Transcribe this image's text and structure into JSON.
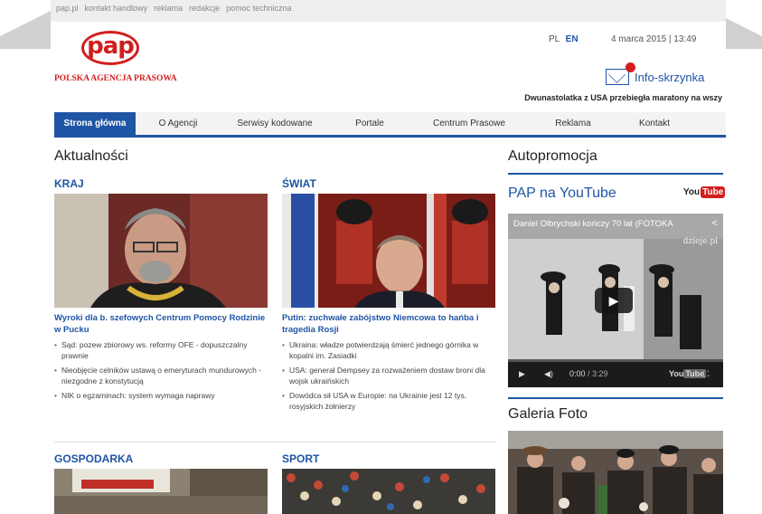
{
  "topbar": {
    "links": [
      "pap.pl",
      "kontakt handlowy",
      "reklama",
      "redakcje",
      "pomoc techniczna"
    ]
  },
  "header": {
    "logo_text": "pap",
    "agency_name": "POLSKA AGENCJA PRASOWA",
    "lang_pl": "PL",
    "lang_en": "EN",
    "date": "4 marca 2015 | 13:49",
    "infobox_label": "Info-skrzynka",
    "ticker": "Dwunastolatka z USA przebiegła maratony na wszy"
  },
  "nav": {
    "items": [
      "Strona główna",
      "O Agencji",
      "Serwisy kodowane",
      "Portale",
      "Centrum Prasowe",
      "Reklama",
      "Kontakt"
    ]
  },
  "main": {
    "section_title": "Aktualności",
    "kraj": {
      "label": "KRAJ",
      "headline": "Wyroki dla b. szefowych Centrum Pomocy Rodzinie w Pucku",
      "bullets": [
        "Sąd: pozew zbiorowy ws. reformy OFE - dopuszczalny prawnie",
        "Nieobjęcie celników ustawą o emeryturach mundurowych - niezgodne z konstytucją",
        "NIK o egzaminach: system wymaga naprawy"
      ]
    },
    "swiat": {
      "label": "ŚWIAT",
      "headline": "Putin: zuchwałe zabójstwo Niemcowa to hańba i tragedia Rosji",
      "bullets": [
        "Ukraina: władze potwierdzają śmierć jednego górnika w kopalni im. Zasiadki",
        "USA: generał Dempsey za rozważeniem dostaw broni dla wojsk ukraińskich",
        "Dowódca sił USA w Europie: na Ukrainie jest 12 tys. rosyjskich żołnierzy"
      ]
    },
    "gospodarka": {
      "label": "GOSPODARKA"
    },
    "sport": {
      "label": "SPORT"
    }
  },
  "side": {
    "section_title": "Autopromocja",
    "youtube_title": "PAP na YouTube",
    "youtube_logo_you": "You",
    "youtube_logo_tube": "Tube",
    "video_title": "Daniel Olbrychski kończy 70 lat (FOTOKA",
    "video_watermark": "dzieje.pl",
    "video_time_current": "0:00",
    "video_time_total": "/ 3:29",
    "gallery_title": "Galeria Foto"
  }
}
